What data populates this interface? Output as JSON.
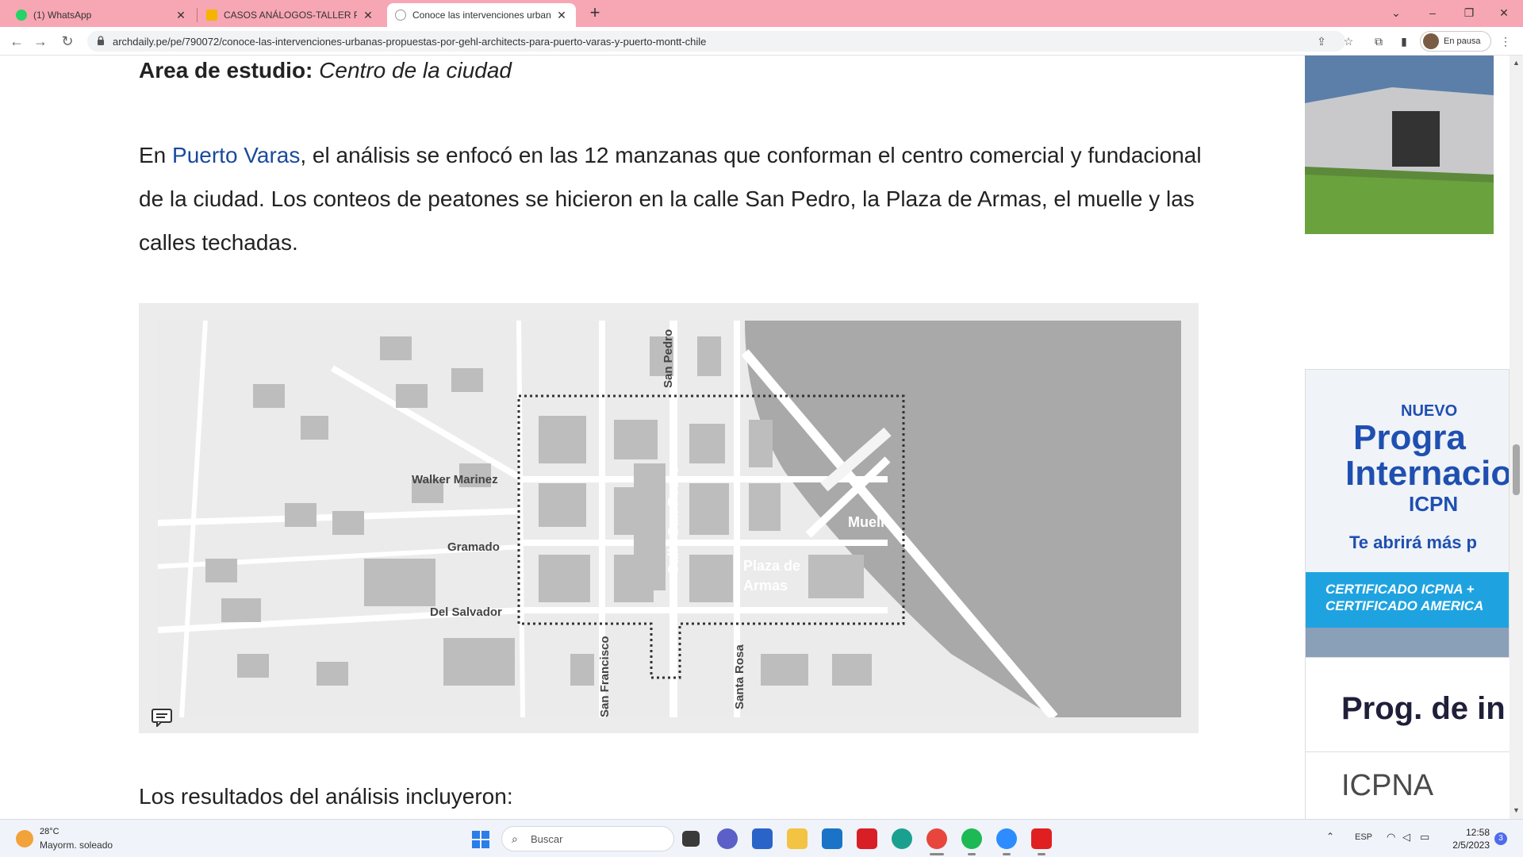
{
  "browser": {
    "tabs": [
      {
        "label": "(1) WhatsApp",
        "icon": "whatsapp-icon",
        "active": false
      },
      {
        "label": "CASOS ANÁLOGOS-TALLER PRE",
        "icon": "slides-icon",
        "active": false
      },
      {
        "label": "Conoce las intervenciones urban",
        "icon": "page-icon",
        "active": true
      }
    ],
    "new_tab_symbol": "+",
    "url": "archdaily.pe/pe/790072/conoce-las-intervenciones-urbanas-propuestas-por-gehl-architects-para-puerto-varas-y-puerto-montt-chile",
    "profile_label": "En pausa"
  },
  "article": {
    "study_area_label": "Area de estudio:",
    "study_area_value": "Centro de la ciudad",
    "paragraph_prefix": "En ",
    "paragraph_link": "Puerto Varas",
    "paragraph_rest": ", el análisis se enfocó en las 12 manzanas que conforman el centro comercial y fundacional de la ciudad. Los conteos de peatones se hicieron en la calle San Pedro, la Plaza de Armas, el muelle y las calles techadas.",
    "map_labels": {
      "san_pedro": "San Pedro",
      "walker_marinez": "Walker Marinez",
      "gramado": "Gramado",
      "del_salvador": "Del Salvador",
      "calle_san_pedro": "Calle San Pedro",
      "plaza_line1": "Plaza de",
      "plaza_line2": "Armas",
      "muelle": "Muelle",
      "san_francisco": "San Francisco",
      "santa_rosa": "Santa Rosa"
    },
    "results_heading": "Los resultados del análisis incluyeron:"
  },
  "sidebar": {
    "ad_prog": "Prog. de in",
    "ad_icpna": "ICPNA"
  },
  "taskbar": {
    "weather_temp": "28°C",
    "weather_desc": "Mayorm. soleado",
    "search_label": "Buscar",
    "lang": "ESP",
    "time": "12:58",
    "date": "2/5/2023",
    "notification_count": "3"
  }
}
